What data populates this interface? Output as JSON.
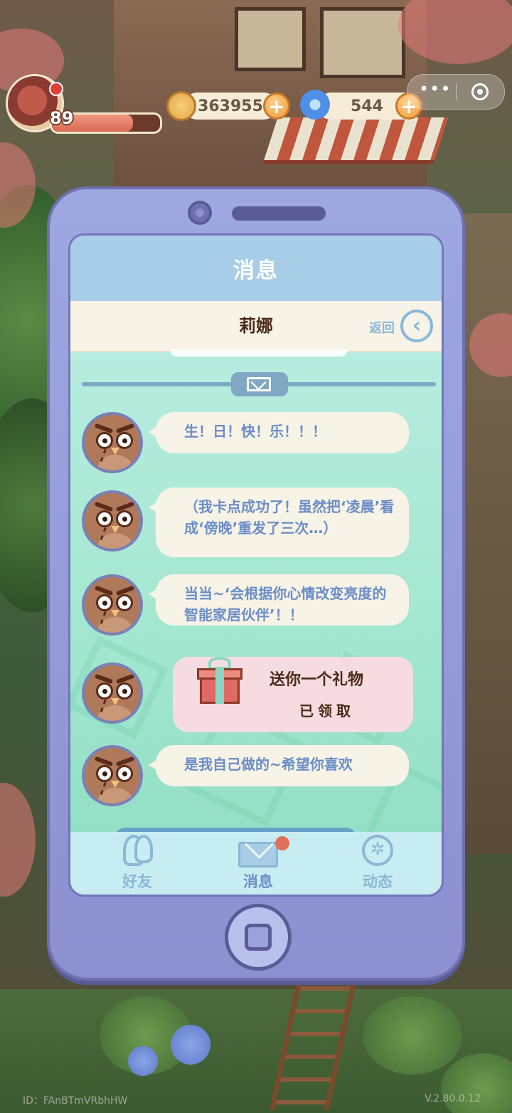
{
  "hud": {
    "level": "89",
    "level_progress": 0.75,
    "coins": "363955",
    "gems": "544",
    "plus_symbol": "+",
    "more_symbol": "•••"
  },
  "screen": {
    "title": "消息",
    "contact_name": "莉娜",
    "back_label": "返回",
    "back_icon": "chevron-left-icon"
  },
  "messages": [
    {
      "text": "生！日！快！乐！！！"
    },
    {
      "text": "（我卡点成功了！虽然把‘凌晨’看成‘傍晚’重发了三次…）"
    },
    {
      "text": "当当~‘会根据你心情改变亮度的智能家居伙伴’！！"
    },
    {
      "gift_title": "送你一个礼物",
      "gift_status": "已领取"
    },
    {
      "text": "是我自己做的~希望你喜欢"
    }
  ],
  "tabs": [
    {
      "label": "好友",
      "icon": "friends-icon"
    },
    {
      "label": "消息",
      "icon": "mail-icon",
      "badge": true
    },
    {
      "label": "动态",
      "icon": "moments-icon"
    }
  ],
  "footer": {
    "id": "ID：FAnBTmVRbhHW",
    "version": "V.2.80.0.12"
  },
  "colors": {
    "bubble_text": "#6b8ec8",
    "tab_text": "#8ab8d8",
    "badge": "#e0705a",
    "phone_body": "#9ea8e0"
  }
}
